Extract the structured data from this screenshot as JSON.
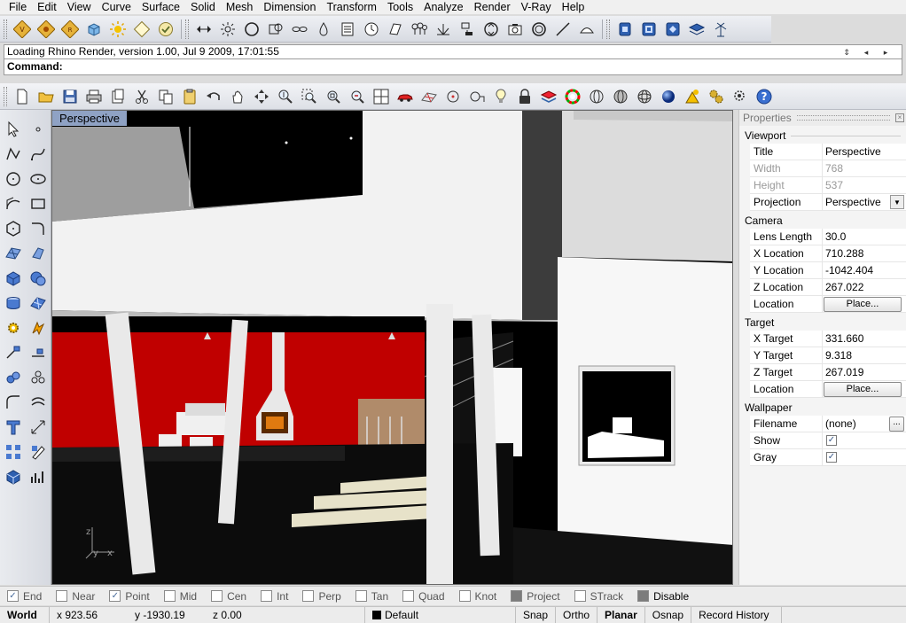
{
  "menu": [
    "File",
    "Edit",
    "View",
    "Curve",
    "Surface",
    "Solid",
    "Mesh",
    "Dimension",
    "Transform",
    "Tools",
    "Analyze",
    "Render",
    "V-Ray",
    "Help"
  ],
  "command": {
    "history": "Loading Rhino Render, version 1.00, Jul  9 2009, 17:01:55",
    "prompt": "Command:"
  },
  "viewport": {
    "title": "Perspective",
    "axis_x": "x",
    "axis_y": "y",
    "axis_z": "z"
  },
  "properties": {
    "header": "Properties",
    "sections": {
      "viewport": "Viewport",
      "camera": "Camera",
      "target": "Target",
      "wallpaper": "Wallpaper"
    },
    "viewport": {
      "title_label": "Title",
      "title_value": "Perspective",
      "width_label": "Width",
      "width_value": "768",
      "height_label": "Height",
      "height_value": "537",
      "projection_label": "Projection",
      "projection_value": "Perspective"
    },
    "camera": {
      "lens_label": "Lens Length",
      "lens_value": "30.0",
      "x_label": "X Location",
      "x_value": "710.288",
      "y_label": "Y Location",
      "y_value": "-1042.404",
      "z_label": "Z Location",
      "z_value": "267.022",
      "loc_label": "Location",
      "loc_button": "Place..."
    },
    "target": {
      "x_label": "X Target",
      "x_value": "331.660",
      "y_label": "Y Target",
      "y_value": "9.318",
      "z_label": "Z Target",
      "z_value": "267.019",
      "loc_label": "Location",
      "loc_button": "Place..."
    },
    "wallpaper": {
      "filename_label": "Filename",
      "filename_value": "(none)",
      "browse": "...",
      "show_label": "Show",
      "show_checked": true,
      "gray_label": "Gray",
      "gray_checked": true
    }
  },
  "osnap": [
    {
      "label": "End",
      "checked": true
    },
    {
      "label": "Near",
      "checked": false
    },
    {
      "label": "Point",
      "checked": true
    },
    {
      "label": "Mid",
      "checked": false
    },
    {
      "label": "Cen",
      "checked": false
    },
    {
      "label": "Int",
      "checked": false
    },
    {
      "label": "Perp",
      "checked": false
    },
    {
      "label": "Tan",
      "checked": false
    },
    {
      "label": "Quad",
      "checked": false
    },
    {
      "label": "Knot",
      "checked": false
    },
    {
      "label": "Project",
      "checked": false,
      "dark": true
    },
    {
      "label": "STrack",
      "checked": false
    },
    {
      "label": "Disable",
      "checked": false,
      "dark": true
    }
  ],
  "status": {
    "cplane": "World",
    "x": "x 923.56",
    "y": "y -1930.19",
    "z": "z 0.00",
    "layer": "Default",
    "snap": "Snap",
    "ortho": "Ortho",
    "planar": "Planar",
    "osnap": "Osnap",
    "history": "Record History"
  },
  "colors": {
    "viewport_title_bg": "#8fa2c4",
    "red_wall": "#c00000"
  }
}
